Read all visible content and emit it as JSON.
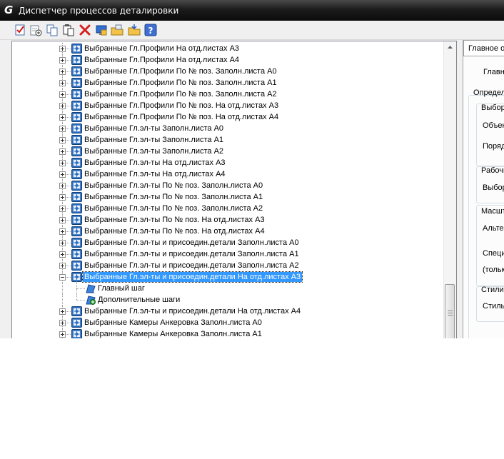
{
  "window": {
    "title": "Диспетчер процессов деталировки"
  },
  "toolbar": {
    "buttons": [
      {
        "icon": "new-checklist-icon"
      },
      {
        "icon": "add-step-icon"
      },
      {
        "icon": "copy-icon"
      },
      {
        "icon": "paste-icon"
      },
      {
        "icon": "delete-icon"
      },
      {
        "icon": "monitor-icon"
      },
      {
        "icon": "folder-export-icon"
      },
      {
        "icon": "folder-import-icon"
      },
      {
        "icon": "help-icon"
      }
    ]
  },
  "tree": {
    "items": [
      {
        "label": "Выбранные Гл.Профили На отд.листах A3"
      },
      {
        "label": "Выбранные Гл.Профили На отд.листах A4"
      },
      {
        "label": "Выбранные Гл.Профили По № поз. Заполн.листа A0"
      },
      {
        "label": "Выбранные Гл.Профили По № поз. Заполн.листа A1"
      },
      {
        "label": "Выбранные Гл.Профили По № поз. Заполн.листа A2"
      },
      {
        "label": "Выбранные Гл.Профили По № поз. На отд.листах A3"
      },
      {
        "label": "Выбранные Гл.Профили По № поз. На отд.листах A4"
      },
      {
        "label": "Выбранные Гл.эл-ты Заполн.листа A0"
      },
      {
        "label": "Выбранные Гл.эл-ты Заполн.листа A1"
      },
      {
        "label": "Выбранные Гл.эл-ты Заполн.листа A2"
      },
      {
        "label": "Выбранные Гл.эл-ты На отд.листах A3"
      },
      {
        "label": "Выбранные Гл.эл-ты На отд.листах A4"
      },
      {
        "label": "Выбранные Гл.эл-ты По № поз. Заполн.листа A0"
      },
      {
        "label": "Выбранные Гл.эл-ты По № поз. Заполн.листа A1"
      },
      {
        "label": "Выбранные Гл.эл-ты По № поз. Заполн.листа A2"
      },
      {
        "label": "Выбранные Гл.эл-ты По № поз. На отд.листах A3"
      },
      {
        "label": "Выбранные Гл.эл-ты По № поз. На отд.листах A4"
      },
      {
        "label": "Выбранные Гл.эл-ты и присоедин.детали Заполн.листа A0"
      },
      {
        "label": "Выбранные Гл.эл-ты и присоедин.детали Заполн.листа A1"
      },
      {
        "label": "Выбранные Гл.эл-ты и присоедин.детали Заполн.листа A2"
      },
      {
        "label": "Выбранные Гл.эл-ты и присоедин.детали На отд.листах A3",
        "expanded": true,
        "selected": true
      },
      {
        "label": "Главный шаг",
        "child": true,
        "icon": "main-step-icon"
      },
      {
        "label": "Дополнительные шаги",
        "child": true,
        "icon": "additional-steps-icon"
      },
      {
        "label": "Выбранные Гл.эл-ты и присоедин.детали На отд.листах A4"
      },
      {
        "label": "Выбранные Камеры Анкеровка Заполн.листа A0"
      },
      {
        "label": "Выбранные Камеры Анкеровка Заполн.листа A1"
      }
    ]
  },
  "properties": {
    "tab_label": "Главное о",
    "labels": [
      "Главнь",
      "Определ",
      "Выбор",
      "Объек",
      "Поряд",
      "Рабочи",
      "Выбор",
      "Масшт",
      "Альте",
      "Специ",
      "(тольк",
      "Стили",
      "Стиль"
    ]
  }
}
